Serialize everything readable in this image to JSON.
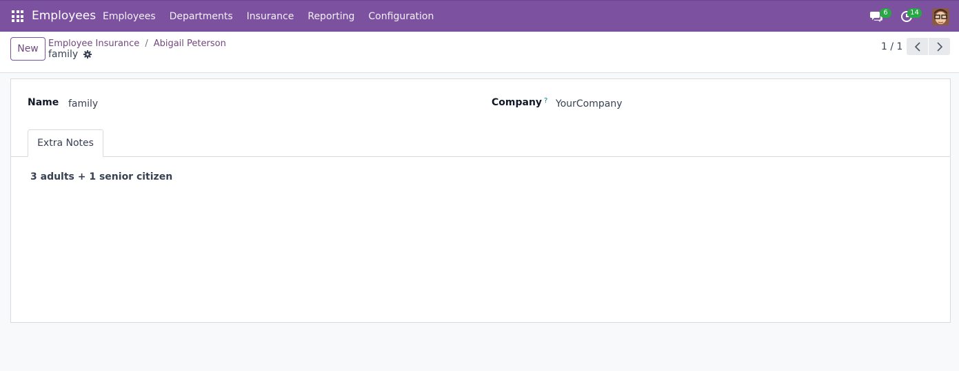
{
  "navbar": {
    "app_title": "Employees",
    "menu": [
      "Employees",
      "Departments",
      "Insurance",
      "Reporting",
      "Configuration"
    ],
    "chat_count": "6",
    "activity_count": "14",
    "color": "#7c52a0"
  },
  "control": {
    "new_label": "New",
    "breadcrumb": [
      "Employee Insurance",
      "Abigail Peterson"
    ],
    "breadcrumb_separator": "/",
    "record_title": "family",
    "pager": "1 / 1"
  },
  "form": {
    "name_label": "Name",
    "name_value": "family",
    "company_label": "Company",
    "company_help": "?",
    "company_value": "YourCompany",
    "tab_label": "Extra Notes",
    "notes": "3 adults + 1 senior citizen"
  }
}
